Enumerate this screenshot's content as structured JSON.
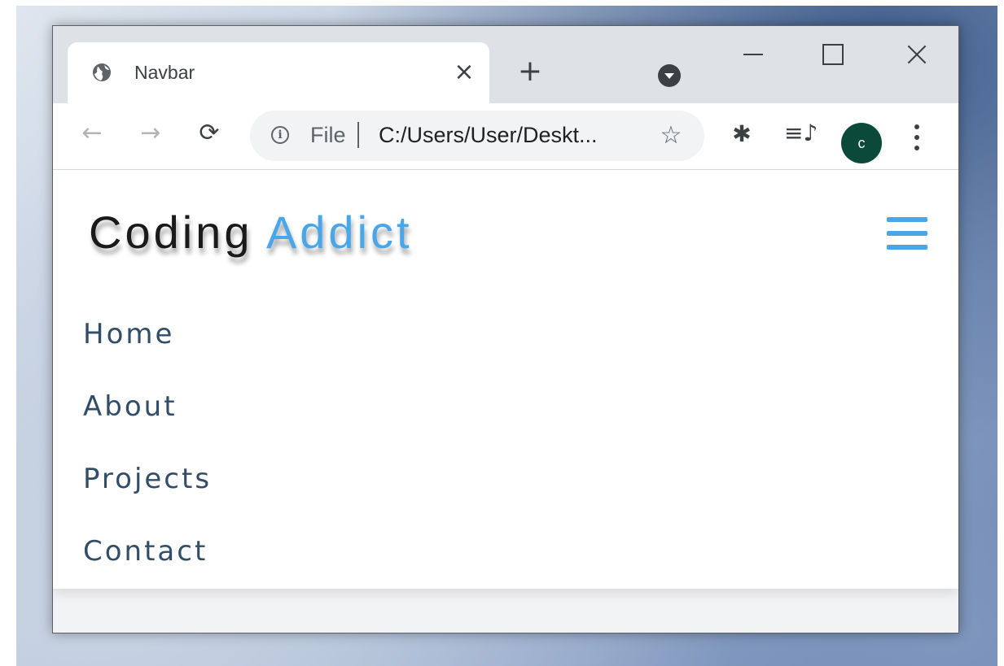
{
  "browser": {
    "tab": {
      "title": "Navbar",
      "close_glyph": "×",
      "favicon": "globe-icon"
    },
    "new_tab_glyph": "+",
    "toolbar": {
      "back_glyph": "←",
      "forward_glyph": "→",
      "reload_glyph": "⟳",
      "address": {
        "info_glyph": "i",
        "scheme_label": "File",
        "url": "C:/Users/User/Deskt..."
      },
      "bookmark_glyph": "☆",
      "extensions_glyph": "✱",
      "media_glyph": "≡♪",
      "avatar_letter": "c",
      "avatar_color": "#0b4a3a"
    }
  },
  "page": {
    "logo": {
      "main": "Coding",
      "accent": "Addict"
    },
    "accent_color": "#49a6e9",
    "menu_icon": "hamburger-icon",
    "nav_links": [
      {
        "label": "Home"
      },
      {
        "label": "About"
      },
      {
        "label": "Projects"
      },
      {
        "label": "Contact"
      }
    ]
  }
}
